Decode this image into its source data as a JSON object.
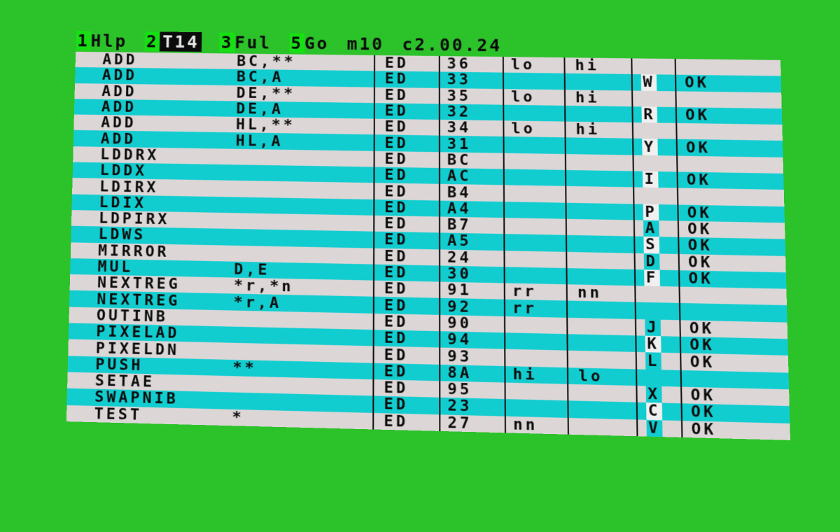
{
  "menu": [
    {
      "key": "1",
      "label": "Hlp",
      "highlight": false
    },
    {
      "key": "2",
      "label": "T14",
      "highlight": true
    },
    {
      "key": "3",
      "label": "Ful",
      "highlight": false
    },
    {
      "key": "5",
      "label": "Go",
      "highlight": false
    }
  ],
  "mode": "m10",
  "version": "c2.00.24",
  "rows": [
    {
      "mn": "ADD",
      "op": "BC,**",
      "pre": "ED",
      "opc": "36",
      "a1": "lo",
      "a2": "hi",
      "key": "",
      "status": ""
    },
    {
      "mn": "ADD",
      "op": "BC,A",
      "pre": "ED",
      "opc": "33",
      "a1": "",
      "a2": "",
      "key": "W",
      "status": "OK"
    },
    {
      "mn": "ADD",
      "op": "DE,**",
      "pre": "ED",
      "opc": "35",
      "a1": "lo",
      "a2": "hi",
      "key": "",
      "status": ""
    },
    {
      "mn": "ADD",
      "op": "DE,A",
      "pre": "ED",
      "opc": "32",
      "a1": "",
      "a2": "",
      "key": "R",
      "status": "OK"
    },
    {
      "mn": "ADD",
      "op": "HL,**",
      "pre": "ED",
      "opc": "34",
      "a1": "lo",
      "a2": "hi",
      "key": "",
      "status": ""
    },
    {
      "mn": "ADD",
      "op": "HL,A",
      "pre": "ED",
      "opc": "31",
      "a1": "",
      "a2": "",
      "key": "Y",
      "status": "OK"
    },
    {
      "mn": "LDDRX",
      "op": "",
      "pre": "ED",
      "opc": "BC",
      "a1": "",
      "a2": "",
      "key": "",
      "status": ""
    },
    {
      "mn": "LDDX",
      "op": "",
      "pre": "ED",
      "opc": "AC",
      "a1": "",
      "a2": "",
      "key": "I",
      "status": "OK"
    },
    {
      "mn": "LDIRX",
      "op": "",
      "pre": "ED",
      "opc": "B4",
      "a1": "",
      "a2": "",
      "key": "",
      "status": ""
    },
    {
      "mn": "LDIX",
      "op": "",
      "pre": "ED",
      "opc": "A4",
      "a1": "",
      "a2": "",
      "key": "P",
      "status": "OK"
    },
    {
      "mn": "LDPIRX",
      "op": "",
      "pre": "ED",
      "opc": "B7",
      "a1": "",
      "a2": "",
      "key": "A",
      "status": "OK"
    },
    {
      "mn": "LDWS",
      "op": "",
      "pre": "ED",
      "opc": "A5",
      "a1": "",
      "a2": "",
      "key": "S",
      "status": "OK"
    },
    {
      "mn": "MIRROR",
      "op": "",
      "pre": "ED",
      "opc": "24",
      "a1": "",
      "a2": "",
      "key": "D",
      "status": "OK"
    },
    {
      "mn": "MUL",
      "op": "D,E",
      "pre": "ED",
      "opc": "30",
      "a1": "",
      "a2": "",
      "key": "F",
      "status": "OK"
    },
    {
      "mn": "NEXTREG",
      "op": "*r,*n",
      "pre": "ED",
      "opc": "91",
      "a1": "rr",
      "a2": "nn",
      "key": "",
      "status": ""
    },
    {
      "mn": "NEXTREG",
      "op": "*r,A",
      "pre": "ED",
      "opc": "92",
      "a1": "rr",
      "a2": "",
      "key": "",
      "status": ""
    },
    {
      "mn": "OUTINB",
      "op": "",
      "pre": "ED",
      "opc": "90",
      "a1": "",
      "a2": "",
      "key": "J",
      "status": "OK"
    },
    {
      "mn": "PIXELAD",
      "op": "",
      "pre": "ED",
      "opc": "94",
      "a1": "",
      "a2": "",
      "key": "K",
      "status": "OK"
    },
    {
      "mn": "PIXELDN",
      "op": "",
      "pre": "ED",
      "opc": "93",
      "a1": "",
      "a2": "",
      "key": "L",
      "status": "OK"
    },
    {
      "mn": "PUSH",
      "op": "**",
      "pre": "ED",
      "opc": "8A",
      "a1": "hi",
      "a2": "lo",
      "key": "",
      "status": ""
    },
    {
      "mn": "SETAE",
      "op": "",
      "pre": "ED",
      "opc": "95",
      "a1": "",
      "a2": "",
      "key": "X",
      "status": "OK"
    },
    {
      "mn": "SWAPNIB",
      "op": "",
      "pre": "ED",
      "opc": "23",
      "a1": "",
      "a2": "",
      "key": "C",
      "status": "OK"
    },
    {
      "mn": "TEST",
      "op": "*",
      "pre": "ED",
      "opc": "27",
      "a1": "nn",
      "a2": "",
      "key": "V",
      "status": "OK"
    }
  ],
  "colors": {
    "background": "#2cc22a",
    "row_light": "#dcd6d6",
    "row_cyan": "#12cdd0",
    "menu_key": "#16e014"
  }
}
